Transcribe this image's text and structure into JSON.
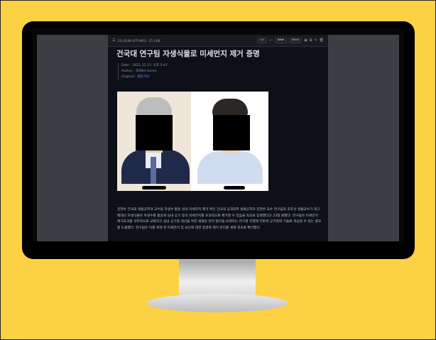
{
  "toolbar": {
    "doc_info": "211.0248 (UTF-8A1) · 25.3 KB",
    "code_label": "<>",
    "save_label": "Save",
    "share_label": "Share"
  },
  "article": {
    "title": "건국대 연구팀 자생식물로 미세먼지 제거 증명",
    "meta": {
      "date": "Date : 2021.12.23. 오후 5:47",
      "author_label": "Author : ",
      "author": "ZDNet Korea",
      "original_label": "Original : ",
      "original_link": "원문기사"
    },
    "body": "김현우 건국대 생물공학과 교수팀 자생수 활동 실내 미세먼지 제거 확인 건국대 공과대학 생물공학과 김현우 교수 연구팀과 최호선 생물교수가 최근 백대산 자생식물은 자생수를 활용해 실내 공기 중의 미세먼지를 효과적으로 제거할 수 있음을 최초로 증명했다고 23일 밝혔다. 연구팀은 미세먼지 제거효과를 과학적으로 규명하고 실내 공기질 개선을 위한 새로운 관리 방안을 모색하는 연구를 진행해 친환경 공기정화 기술로 적용할 수 있는 결과를 도출했다. 연구팀은 이를 위해 현 미세먼지 및 요인에 대한 종합적 제거 관리를 세계 최초로 확인했다."
  },
  "colors": {
    "background": "#fcd244",
    "doc_bg": "#0d1117",
    "link": "#58a6ff"
  },
  "icons": [
    "menu-icon",
    "code-icon",
    "file-icon",
    "monitor-icon",
    "copy-icon",
    "edit-icon",
    "trash-icon"
  ]
}
